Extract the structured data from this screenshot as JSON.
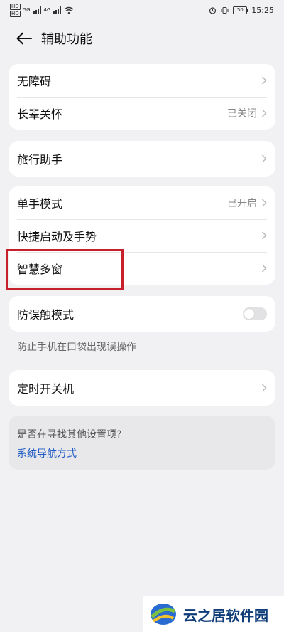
{
  "status_bar": {
    "sim1": "HD",
    "sim2": "HD",
    "net1": "5G",
    "net2": "4G",
    "battery": "50",
    "time": "15:25",
    "icons": [
      "signal-icon",
      "wifi-icon",
      "alarm-icon",
      "vibrate-icon",
      "battery-icon"
    ]
  },
  "header": {
    "title": "辅助功能",
    "back_icon": "arrow-left-icon"
  },
  "groups": [
    {
      "items": [
        {
          "label": "无障碍",
          "value": ""
        },
        {
          "label": "长辈关怀",
          "value": "已关闭"
        }
      ]
    },
    {
      "items": [
        {
          "label": "旅行助手",
          "value": ""
        }
      ]
    },
    {
      "items": [
        {
          "label": "单手模式",
          "value": "已开启"
        },
        {
          "label": "快捷启动及手势",
          "value": ""
        },
        {
          "label": "智慧多窗",
          "value": ""
        }
      ]
    },
    {
      "items": [
        {
          "label": "防误触模式",
          "toggle": false
        }
      ],
      "hint": "防止手机在口袋出现误操作"
    },
    {
      "items": [
        {
          "label": "定时开关机",
          "value": ""
        }
      ]
    }
  ],
  "search_prompt": {
    "question": "是否在寻找其他设置项?",
    "link": "系统导航方式"
  },
  "watermark": {
    "text": "云之居软件园"
  },
  "colors": {
    "background": "#f1f1f3",
    "card": "#ffffff",
    "link": "#1f5ac4",
    "highlight": "#c8202a"
  }
}
